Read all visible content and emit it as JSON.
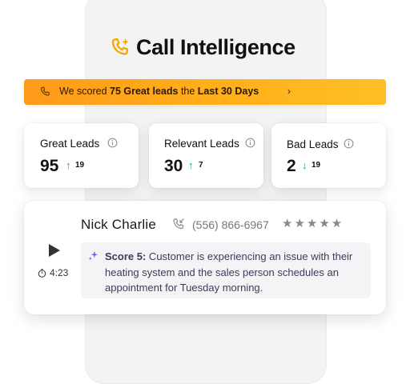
{
  "brand": {
    "name": "Call Intelligence",
    "accent_color": "#f5a400",
    "icon": "phone-sparkle-icon"
  },
  "banner": {
    "prefix": "We scored ",
    "highlight": "75 Great leads",
    "middle": " the ",
    "period": "Last 30 Days",
    "chevron": "›",
    "icon": "phone-icon"
  },
  "stats": [
    {
      "title": "Great Leads",
      "value": "95",
      "trend": "up",
      "arrow": "↑",
      "delta": "19"
    },
    {
      "title": "Relevant Leads",
      "value": "30",
      "trend": "up",
      "arrow": "↑",
      "delta": "7"
    },
    {
      "title": "Bad Leads",
      "value": "2",
      "trend": "down",
      "arrow": "↓",
      "delta": "19"
    }
  ],
  "call": {
    "name": "Nick Charlie",
    "phone": "(556) 866-6967",
    "stars": "★★★★★",
    "rating": 5,
    "duration": "4:23",
    "summary_label": "Score 5:",
    "summary_text": " Customer is experiencing an issue with their heating system and the sales person schedules an appointment for Tuesday morning."
  }
}
